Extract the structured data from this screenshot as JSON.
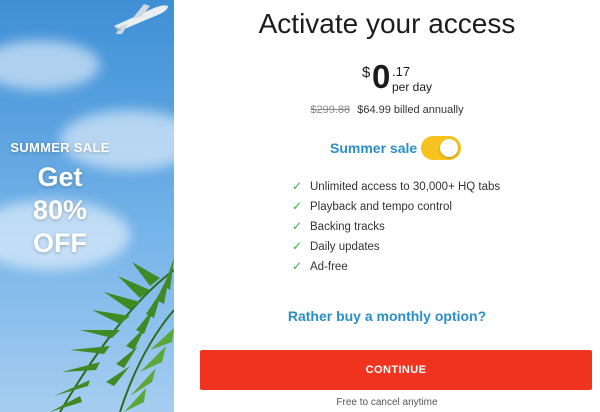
{
  "promo": {
    "eyebrow": "SUMMER SALE",
    "line1": "Get",
    "line2": "80%",
    "line3": "OFF"
  },
  "header": {
    "title": "Activate your access"
  },
  "price": {
    "currency": "$",
    "whole": "0",
    "cents": ".17",
    "period": "per day"
  },
  "billing": {
    "old_price": "$299.88",
    "new_price": "$64.99 billed annually"
  },
  "sale_toggle": {
    "label": "Summer sale",
    "enabled": true,
    "color": "#f6c21b"
  },
  "features": [
    "Unlimited access to 30,000+ HQ tabs",
    "Playback and tempo control",
    "Backing tracks",
    "Daily updates",
    "Ad-free"
  ],
  "monthly_link": "Rather buy a monthly option?",
  "continue_button": "CONTINUE",
  "footnote": "Free to cancel anytime",
  "colors": {
    "accent_blue": "#2a8fc9",
    "cta_red": "#f0341f",
    "check_green": "#3cb24a"
  }
}
